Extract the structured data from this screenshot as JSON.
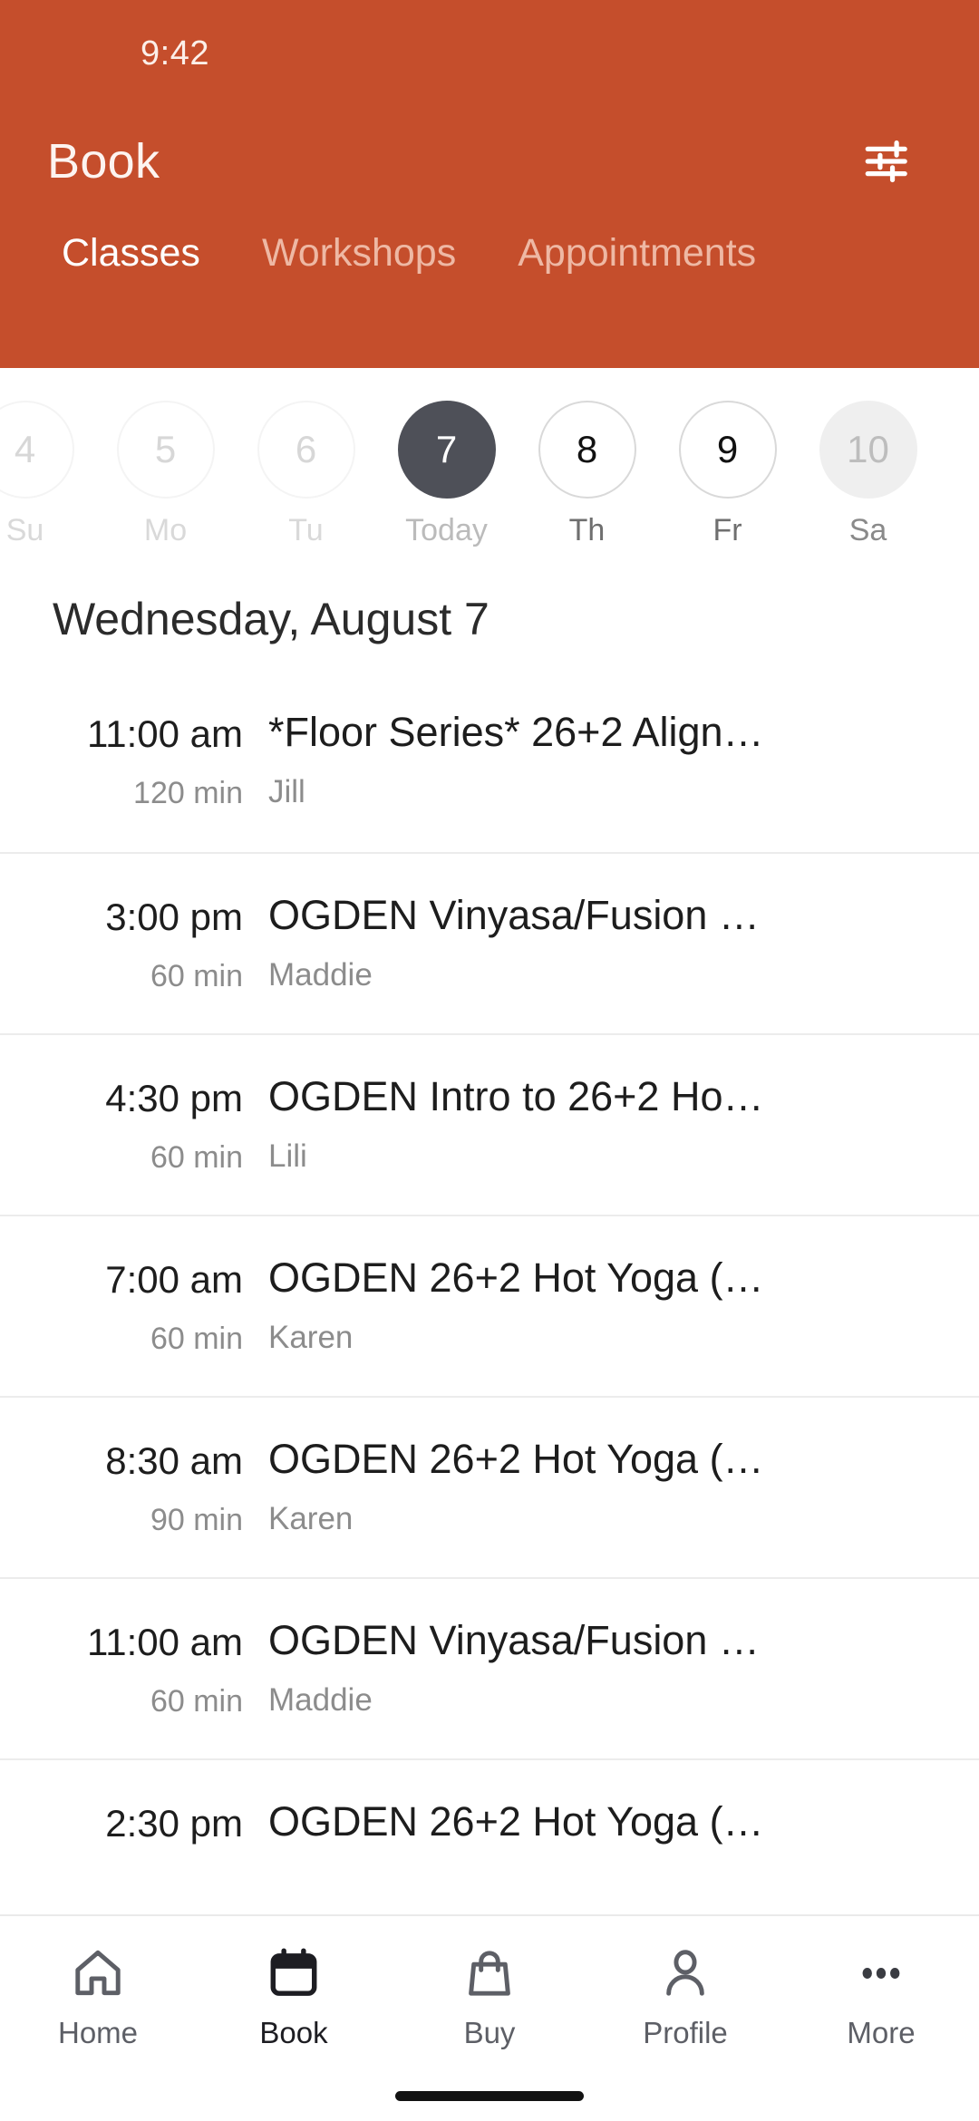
{
  "statusbar": {
    "time": "9:42"
  },
  "header": {
    "title": "Book",
    "filter_icon": "tune-filter-icon",
    "accent_color": "#C54E2C",
    "tabs": [
      {
        "label": "Classes",
        "active": true
      },
      {
        "label": "Workshops",
        "active": false
      },
      {
        "label": "Appointments",
        "active": false
      }
    ]
  },
  "datestrip": {
    "days": [
      {
        "num": "4",
        "label": "Su",
        "state": "past"
      },
      {
        "num": "5",
        "label": "Mo",
        "state": "past"
      },
      {
        "num": "6",
        "label": "Tu",
        "state": "past"
      },
      {
        "num": "7",
        "label": "Today",
        "state": "selected"
      },
      {
        "num": "8",
        "label": "Th",
        "state": "future"
      },
      {
        "num": "9",
        "label": "Fr",
        "state": "future"
      },
      {
        "num": "10",
        "label": "Sa",
        "state": "edge"
      }
    ],
    "selected_color": "#4E5058"
  },
  "schedule": {
    "day_heading": "Wednesday, August 7",
    "classes": [
      {
        "time": "11:00 am",
        "duration": "120 min",
        "name": "*Floor Series* 26+2 Align…",
        "instructor": "Jill"
      },
      {
        "time": "3:00 pm",
        "duration": "60 min",
        "name": "OGDEN Vinyasa/Fusion …",
        "instructor": "Maddie"
      },
      {
        "time": "4:30 pm",
        "duration": "60 min",
        "name": "OGDEN Intro to 26+2 Ho…",
        "instructor": "Lili"
      },
      {
        "time": "7:00 am",
        "duration": "60 min",
        "name": "OGDEN 26+2 Hot Yoga (…",
        "instructor": "Karen"
      },
      {
        "time": "8:30 am",
        "duration": "90 min",
        "name": "OGDEN 26+2 Hot Yoga (…",
        "instructor": "Karen"
      },
      {
        "time": "11:00 am",
        "duration": "60 min",
        "name": "OGDEN Vinyasa/Fusion …",
        "instructor": "Maddie"
      },
      {
        "time": "2:30 pm",
        "duration": "",
        "name": "OGDEN 26+2 Hot Yoga (…",
        "instructor": ""
      }
    ]
  },
  "bottomnav": {
    "items": [
      {
        "label": "Home",
        "icon": "home-icon",
        "active": false
      },
      {
        "label": "Book",
        "icon": "calendar-icon",
        "active": true
      },
      {
        "label": "Buy",
        "icon": "bag-icon",
        "active": false
      },
      {
        "label": "Profile",
        "icon": "person-icon",
        "active": false
      },
      {
        "label": "More",
        "icon": "ellipsis-icon",
        "active": false
      }
    ]
  }
}
